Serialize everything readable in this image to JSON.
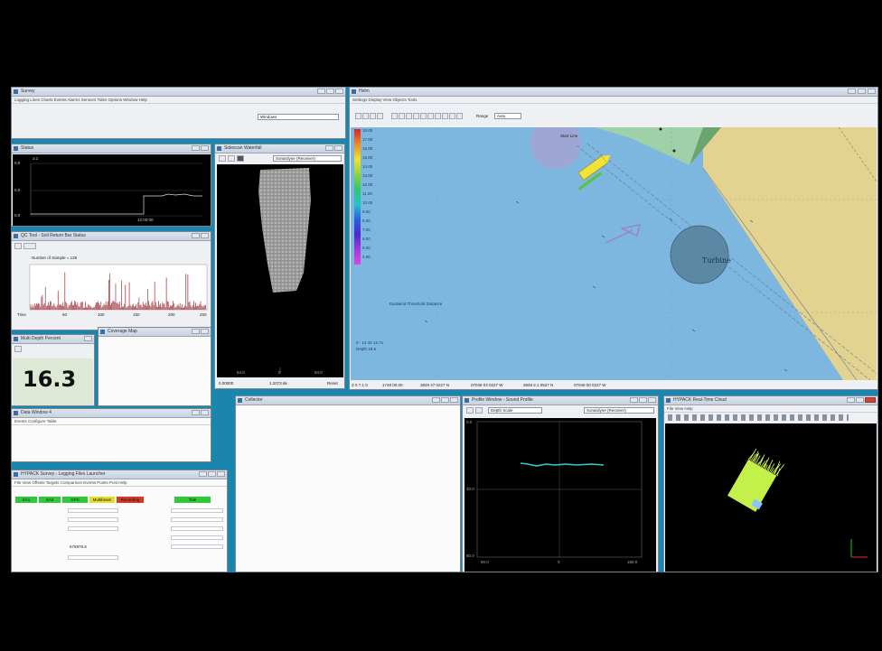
{
  "windows": {
    "survey": {
      "title": "Survey",
      "menu": "Logging  Lines  Charts  Events  Alarms  Sensors  Tides  Options  Window  Help",
      "dropdown": "Windows"
    },
    "status": {
      "title": "Status",
      "value": "3.1",
      "ylabels": [
        "0.0",
        "0.0",
        "0.0"
      ],
      "xlabel": "12:00:00"
    },
    "qc": {
      "title": "QC Tool - Soil Return Bar Status",
      "subtitle": "Number of Sample = 128",
      "xlabels": [
        "Time",
        "50",
        "100",
        "150",
        "200",
        "250"
      ]
    },
    "depth": {
      "title": "Multi Depth Percent",
      "value": "16.3"
    },
    "coverage": {
      "title": "Coverage Map"
    },
    "sidescan": {
      "title": "Sidescan Waterfall",
      "dropdown": "Sonardyne (Receiver)",
      "xlabels": [
        "54.0",
        "0",
        "54.0"
      ],
      "footer": [
        "0.00000",
        "1.2073.6k",
        "Reset"
      ]
    },
    "navmap": {
      "title": "Helm",
      "menu": "Settings  Display  View  Objects  Tools",
      "range_label": "Range",
      "range_value": "Auto",
      "legend": [
        "18.00",
        "17.00",
        "16.00",
        "15.00",
        "14.00",
        "13.00",
        "12.00",
        "11.00",
        "10.00",
        "9.00",
        "8.00",
        "7.00",
        "6.00",
        "5.00",
        "4.00"
      ],
      "labels": {
        "start": "Start Line",
        "target": "Turbine",
        "note": "Eastwind Threshold Distance",
        "scale_a": "0 - 14 44 12.7s",
        "scale_b": "Depth  18.6"
      },
      "status": [
        "Z 0 7.1 0",
        "1749 00.00",
        "3849 47 0227 N",
        "07048 03 0227 W",
        "3849 2.1 0527 N",
        "07049 00 0227 W"
      ]
    },
    "datatable": {
      "title": "Data Window 4",
      "menu": "Events  Configure  Table"
    },
    "collector": {
      "title": "Collector"
    },
    "profile": {
      "title": "Profile Window - Sound Profile",
      "dropdown1": "Depth Scale",
      "dropdown2": "Sonardyne (Receiver)",
      "ylabels": [
        "0.0",
        "40.0",
        "80.0"
      ],
      "xlabels": [
        "90.0",
        "0",
        "180.0"
      ]
    },
    "threed": {
      "title": "HYPACK Real-Time Cloud",
      "menu": "File  View  Help"
    },
    "logging": {
      "title": "HYPACK Survey - Logging Files Launcher",
      "menu": "File  View  Offsets  Targets  Comparison  Events  Points  Post  Help",
      "status": [
        {
          "label": "SA1",
          "color": "#31c93c"
        },
        {
          "label": "SA2",
          "color": "#31c93c"
        },
        {
          "label": "GPS",
          "color": "#31c93c"
        },
        {
          "label": "Multibeam",
          "color": "#e6dd2a"
        },
        {
          "label": "Recording",
          "color": "#d8362b"
        },
        {
          "label": "Tide",
          "color": "#31c93c"
        }
      ],
      "value": "676978.8"
    }
  },
  "colors": {
    "water": "#7db6df",
    "land": "#e4d390",
    "shoal": "#9fd0a8",
    "qcLine": "#b51c25",
    "profileLine": "#33c9c9",
    "cloud": "#c4f04a"
  }
}
